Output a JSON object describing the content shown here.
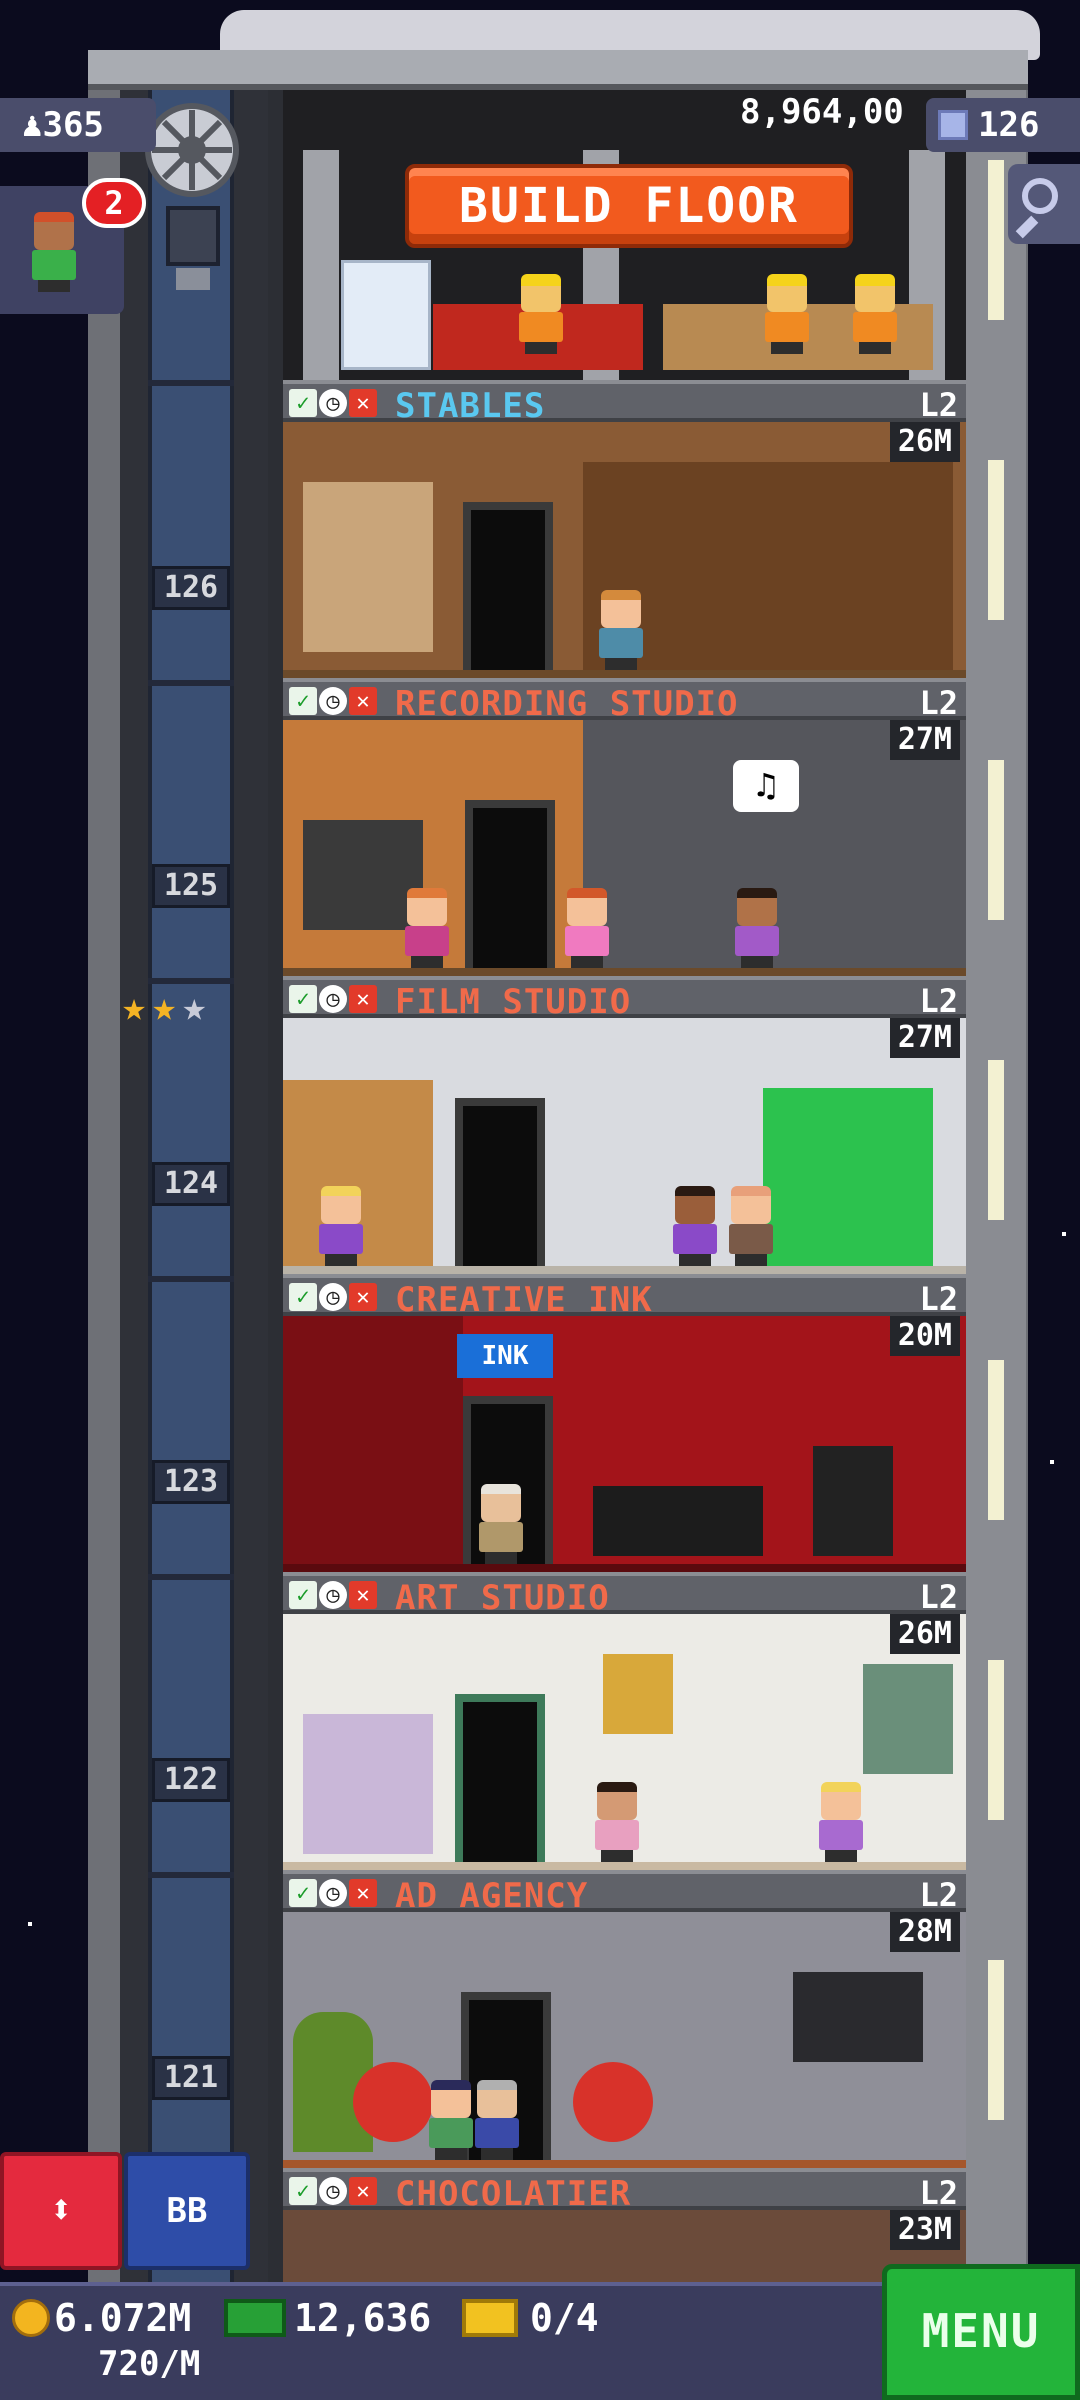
{
  "hud": {
    "population": "365",
    "coins_top": "8,964,00",
    "floor_count": "126",
    "notification_count": "2"
  },
  "build_floor": {
    "label": "BUILD FLOOR"
  },
  "elevator": {
    "floor_labels": [
      "126",
      "125",
      "124",
      "123",
      "122",
      "121"
    ],
    "stars_filled": 2,
    "stars_total": 3
  },
  "floors": [
    {
      "name": "STABLES",
      "level": "L2",
      "income": "26M",
      "name_color": "#5ac8f0",
      "wall": "#8a5b35"
    },
    {
      "name": "RECORDING STUDIO",
      "level": "L2",
      "income": "27M",
      "name_color": "#f06a4a",
      "wall": "#c57a3a"
    },
    {
      "name": "FILM STUDIO",
      "level": "L2",
      "income": "27M",
      "name_color": "#f06a4a",
      "wall": "#d9dbe0"
    },
    {
      "name": "CREATIVE INK",
      "level": "L2",
      "income": "20M",
      "name_color": "#f06a4a",
      "wall": "#a3141a"
    },
    {
      "name": "ART STUDIO",
      "level": "L2",
      "income": "26M",
      "name_color": "#f06a4a",
      "wall": "#ecebe6"
    },
    {
      "name": "AD AGENCY",
      "level": "L2",
      "income": "28M",
      "name_color": "#f06a4a",
      "wall": "#8f8f98"
    },
    {
      "name": "CHOCOLATIER",
      "level": "L2",
      "income": "23M",
      "name_color": "#f06a4a",
      "wall": "#6b4b3a"
    }
  ],
  "bottom": {
    "coins": "6.072M",
    "rate": "720/M",
    "bux": "12,636",
    "tickets": "0/4",
    "menu_label": "MENU",
    "bb_label": "BB",
    "elevator_label": "⬍"
  }
}
